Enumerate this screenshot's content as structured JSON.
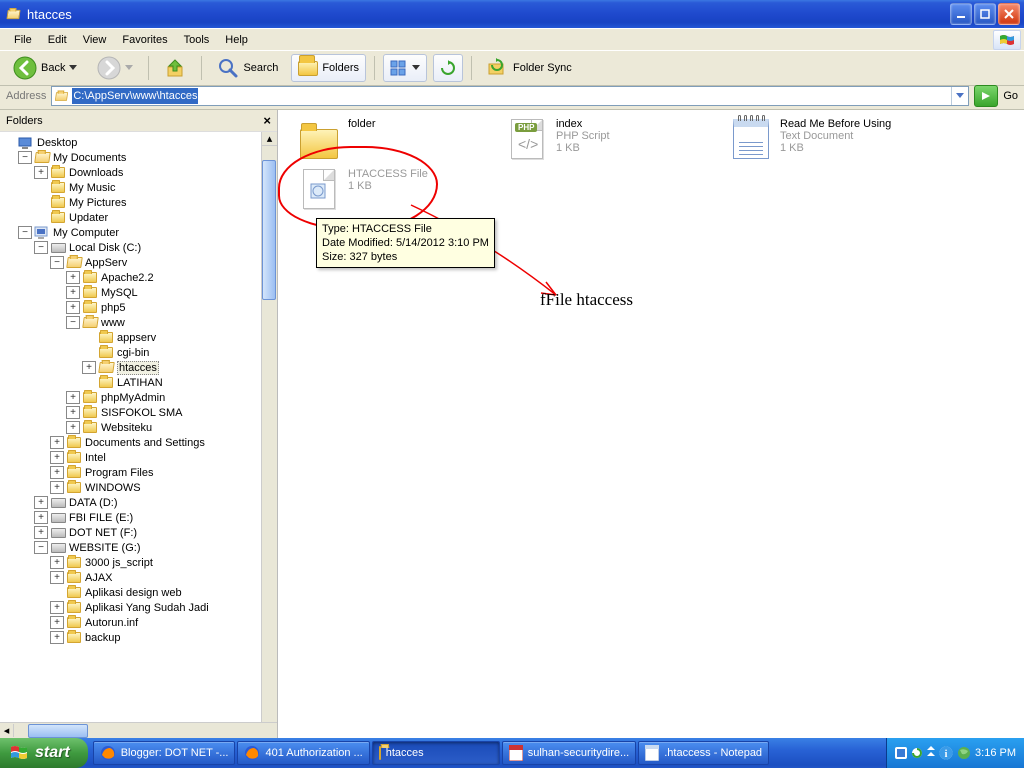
{
  "window": {
    "title": "htacces"
  },
  "menu": {
    "file": "File",
    "edit": "Edit",
    "view": "View",
    "favorites": "Favorites",
    "tools": "Tools",
    "help": "Help"
  },
  "toolbar": {
    "back": "Back",
    "search": "Search",
    "folders": "Folders",
    "foldersync": "Folder Sync"
  },
  "address": {
    "label": "Address",
    "path": "C:\\AppServ\\www\\htacces",
    "go": "Go"
  },
  "sidebar": {
    "title": "Folders",
    "items": [
      {
        "depth": 0,
        "tw": "",
        "icon": "desktop",
        "label": "Desktop"
      },
      {
        "depth": 1,
        "tw": "-",
        "icon": "folder-open",
        "label": "My Documents"
      },
      {
        "depth": 2,
        "tw": "+",
        "icon": "folder",
        "label": "Downloads"
      },
      {
        "depth": 2,
        "tw": "",
        "icon": "folder",
        "label": "My Music"
      },
      {
        "depth": 2,
        "tw": "",
        "icon": "folder",
        "label": "My Pictures"
      },
      {
        "depth": 2,
        "tw": "",
        "icon": "folder",
        "label": "Updater"
      },
      {
        "depth": 1,
        "tw": "-",
        "icon": "computer",
        "label": "My Computer"
      },
      {
        "depth": 2,
        "tw": "-",
        "icon": "drive",
        "label": "Local Disk (C:)"
      },
      {
        "depth": 3,
        "tw": "-",
        "icon": "folder-open",
        "label": "AppServ"
      },
      {
        "depth": 4,
        "tw": "+",
        "icon": "folder",
        "label": "Apache2.2"
      },
      {
        "depth": 4,
        "tw": "+",
        "icon": "folder",
        "label": "MySQL"
      },
      {
        "depth": 4,
        "tw": "+",
        "icon": "folder",
        "label": "php5"
      },
      {
        "depth": 4,
        "tw": "-",
        "icon": "folder-open",
        "label": "www"
      },
      {
        "depth": 5,
        "tw": "",
        "icon": "folder",
        "label": "appserv"
      },
      {
        "depth": 5,
        "tw": "",
        "icon": "folder",
        "label": "cgi-bin"
      },
      {
        "depth": 5,
        "tw": "+",
        "icon": "folder-open",
        "label": "htacces",
        "selected": true
      },
      {
        "depth": 5,
        "tw": "",
        "icon": "folder",
        "label": "LATIHAN"
      },
      {
        "depth": 4,
        "tw": "+",
        "icon": "folder",
        "label": "phpMyAdmin"
      },
      {
        "depth": 4,
        "tw": "+",
        "icon": "folder",
        "label": "SISFOKOL SMA"
      },
      {
        "depth": 4,
        "tw": "+",
        "icon": "folder",
        "label": "Websiteku"
      },
      {
        "depth": 3,
        "tw": "+",
        "icon": "folder",
        "label": "Documents and Settings"
      },
      {
        "depth": 3,
        "tw": "+",
        "icon": "folder",
        "label": "Intel"
      },
      {
        "depth": 3,
        "tw": "+",
        "icon": "folder",
        "label": "Program Files"
      },
      {
        "depth": 3,
        "tw": "+",
        "icon": "folder",
        "label": "WINDOWS"
      },
      {
        "depth": 2,
        "tw": "+",
        "icon": "drive",
        "label": "DATA (D:)"
      },
      {
        "depth": 2,
        "tw": "+",
        "icon": "drive",
        "label": "FBI FILE (E:)"
      },
      {
        "depth": 2,
        "tw": "+",
        "icon": "drive",
        "label": "DOT NET (F:)"
      },
      {
        "depth": 2,
        "tw": "-",
        "icon": "drive",
        "label": "WEBSITE (G:)"
      },
      {
        "depth": 3,
        "tw": "+",
        "icon": "folder",
        "label": "3000 js_script"
      },
      {
        "depth": 3,
        "tw": "+",
        "icon": "folder",
        "label": "AJAX"
      },
      {
        "depth": 3,
        "tw": "",
        "icon": "folder",
        "label": "Aplikasi design web"
      },
      {
        "depth": 3,
        "tw": "+",
        "icon": "folder",
        "label": "Aplikasi Yang Sudah Jadi"
      },
      {
        "depth": 3,
        "tw": "+",
        "icon": "folder",
        "label": "Autorun.inf"
      },
      {
        "depth": 3,
        "tw": "+",
        "icon": "folder",
        "label": "backup"
      }
    ]
  },
  "files": {
    "folder": {
      "name": "folder"
    },
    "htaccess": {
      "name": "",
      "type": "HTACCESS File",
      "size": "1 KB"
    },
    "index": {
      "name": "index",
      "type": "PHP Script",
      "size": "1 KB"
    },
    "readme": {
      "name": "Read Me Before Using",
      "type": "Text Document",
      "size": "1 KB"
    }
  },
  "tooltip": {
    "line1": "Type: HTACCESS File",
    "line2": "Date Modified: 5/14/2012 3:10 PM",
    "line3": "Size: 327 bytes"
  },
  "annotation": {
    "text": "fFile htaccess"
  },
  "taskbar": {
    "start": "start",
    "items": [
      {
        "label": "Blogger: DOT NET -..."
      },
      {
        "label": "401 Authorization ..."
      },
      {
        "label": "htacces",
        "active": true
      },
      {
        "label": "sulhan-securitydire..."
      },
      {
        "label": ".htaccess - Notepad"
      }
    ],
    "clock": "3:16 PM"
  }
}
